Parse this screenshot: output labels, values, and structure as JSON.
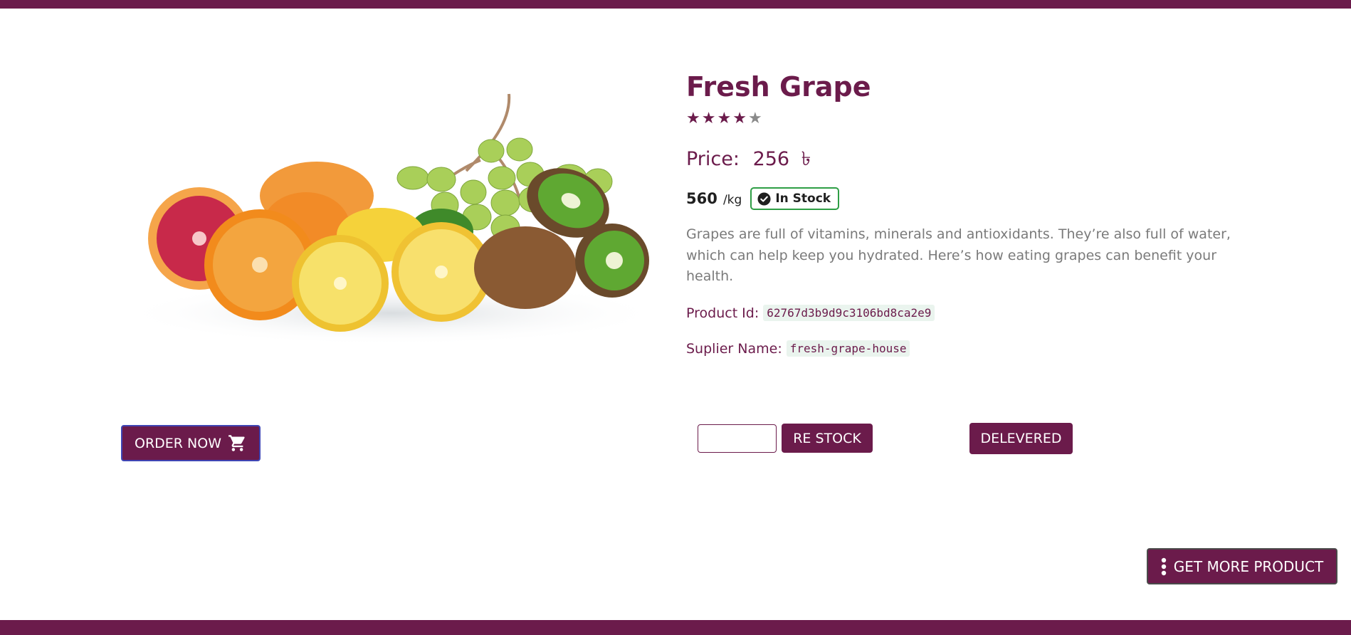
{
  "product": {
    "title": "Fresh Grape",
    "rating": 4,
    "rating_max": 5,
    "price_label": "Price:",
    "price_value": "256",
    "currency_symbol": "৳",
    "quantity": "560",
    "unit": "/kg",
    "stock_status": "In Stock",
    "description": "Grapes are full of vitamins, minerals and antioxidants. They’re also full of water, which can help keep you hydrated. Here’s how eating grapes can benefit your health.",
    "product_id_label": "Product Id:",
    "product_id": "62767d3b9d9c3106bd8ca2e9",
    "supplier_label": "Suplier Name:",
    "supplier_name": "fresh-grape-house"
  },
  "actions": {
    "order_now_label": "ORDER NOW",
    "restock_input_value": "",
    "restock_input_placeholder": "",
    "restock_label": "RE STOCK",
    "delivered_label": "DELEVERED",
    "get_more_label": "GET MORE PRODUCT"
  },
  "icons": {
    "cart": "cart-icon",
    "check": "check-circle-icon",
    "star": "star-icon",
    "kebab": "kebab-icon"
  },
  "colors": {
    "brand": "#6b1b4b",
    "in_stock_border": "#2e9e45",
    "star_empty": "#8a8a8a",
    "chip_bg": "#eaf4ee",
    "description_text": "#7a7a7a"
  }
}
